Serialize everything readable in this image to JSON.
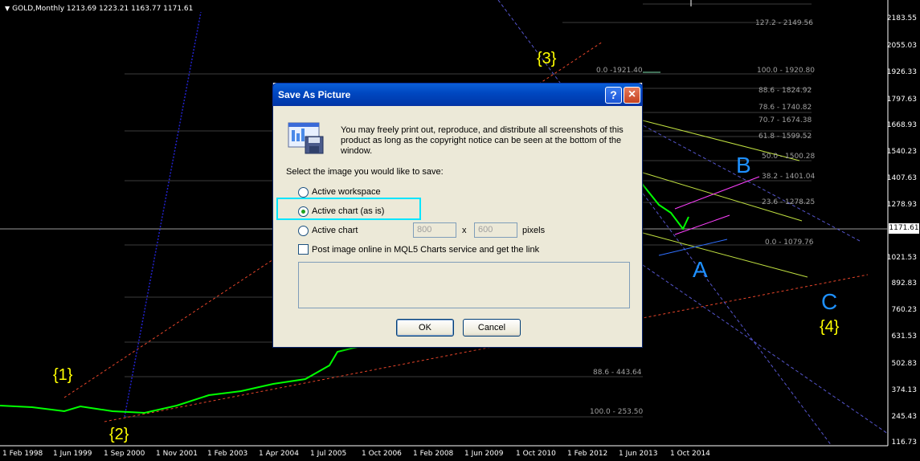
{
  "chart": {
    "title": "GOLD,Monthly  1213.69 1223.21 1163.77 1171.61",
    "current_price": "1171.61",
    "price_axis": [
      "2183.55",
      "2055.03",
      "1926.33",
      "1797.63",
      "1668.93",
      "1540.23",
      "1407.63",
      "1278.93",
      "1021.53",
      "892.83",
      "760.23",
      "631.53",
      "502.83",
      "374.13",
      "245.43",
      "116.73"
    ],
    "date_axis": [
      "1 Feb 1998",
      "1 Jun 1999",
      "1 Sep 2000",
      "1 Nov 2001",
      "1 Feb 2003",
      "1 Apr 2004",
      "1 Jul 2005",
      "1 Oct 2006",
      "1 Feb 2008",
      "1 Jun 2009",
      "1 Oct 2010",
      "1 Feb 2012",
      "1 Jun 2013",
      "1 Oct 2014"
    ],
    "fib_labels": [
      "127.2 - 2149.56",
      "0.0 -1921.40",
      "100.0 - 1920.80",
      "88.6 - 1824.92",
      "78.6 - 1740.82",
      "70.7 - 1674.38",
      "61.8 - 1599.52",
      "50.0 - 1500.28",
      "38.2 - 1401.04",
      "23.6 - 1278.25",
      "0.0 - 1079.76",
      "88.6 - 443.64",
      "100.0 - 253.50"
    ],
    "waves": {
      "w1": "{1}",
      "w2": "{2}",
      "w3": "{3}",
      "w4": "{4}",
      "a": "A",
      "b": "B",
      "c": "C"
    },
    "colors": {
      "wave_yellow": "#ffff00",
      "wave_blue": "#1e90ff",
      "candle": "#00ff00"
    }
  },
  "dialog": {
    "title": "Save As Picture",
    "help_label": "?",
    "close_label": "×",
    "icon": "save-picture-icon",
    "notice": "You may freely print out, reproduce, and distribute all screenshots of this product as long as the copyright notice can be seen at the bottom of the window.",
    "prompt": "Select the image you would like to save:",
    "options": [
      "Active workspace",
      "Active chart (as is)",
      "Active chart"
    ],
    "selected_option": "Active chart (as is)",
    "width_value": "800",
    "height_value": "600",
    "x_label": "x",
    "pixels_label": "pixels",
    "post_online_label": "Post image online in MQL5 Charts service and get the link",
    "ok_label": "OK",
    "cancel_label": "Cancel"
  }
}
